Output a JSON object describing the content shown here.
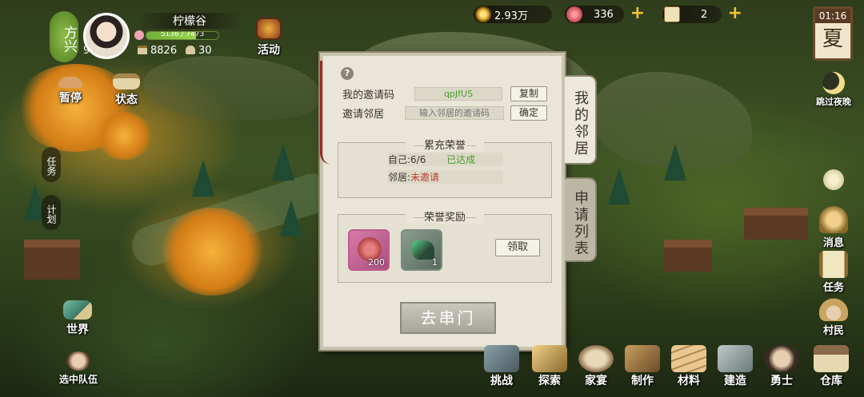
{
  "top_bar": {
    "coins": {
      "icon": "coin-icon",
      "value": "2.93万"
    },
    "gems": {
      "icon": "gem-icon",
      "value": "336"
    },
    "tickets": {
      "icon": "ticket-icon",
      "value": "2"
    },
    "clock": {
      "time": "01:16",
      "season": "夏"
    }
  },
  "player": {
    "village_badge": "方兴",
    "name": "柠檬谷",
    "level": "9",
    "hp_text": "5136 / 7473",
    "hp_ratio": 0.69,
    "prosperity": "8826",
    "population": "30"
  },
  "left_buttons": {
    "activity": "活动",
    "pause": "暂停",
    "status": "状态",
    "task": "任务",
    "plan": "计划",
    "world": "世界",
    "select_team": "选中队伍"
  },
  "panel": {
    "help_symbol": "?",
    "my_code_label": "我的邀请码",
    "my_code_value": "qpJfUS",
    "copy_button": "复制",
    "invite_label": "邀请邻居",
    "invite_placeholder": "输入邻居的邀请码",
    "confirm_button": "确定",
    "honor_title": "累充荣誉",
    "self_label": "自己:6/6",
    "self_status": "已达成",
    "neighbor_label": "邻居:",
    "neighbor_status": "未邀请",
    "reward_title": "荣誉奖励",
    "rewards": [
      {
        "icon": "medal-icon",
        "count": "200"
      },
      {
        "icon": "jade-stone-icon",
        "count": "1"
      }
    ],
    "claim_button": "领取",
    "go_button": "去串门"
  },
  "side_tabs": {
    "my_neighbors": "我的邻居",
    "apply_list": "申请列表"
  },
  "right_buttons": {
    "skip_night": "跳过夜晚",
    "messages": "消息",
    "tasks": "任务",
    "villagers": "村民"
  },
  "dock": [
    {
      "label": "挑战",
      "icon": "challenge-icon"
    },
    {
      "label": "探索",
      "icon": "explore-icon"
    },
    {
      "label": "家宴",
      "icon": "feast-icon"
    },
    {
      "label": "制作",
      "icon": "craft-icon"
    },
    {
      "label": "材料",
      "icon": "materials-icon"
    },
    {
      "label": "建造",
      "icon": "build-icon"
    },
    {
      "label": "勇士",
      "icon": "warrior-icon"
    },
    {
      "label": "仓库",
      "icon": "warehouse-icon"
    }
  ],
  "colors": {
    "accent_gold": "#f2c23a",
    "achieved_green": "#4a9a2a",
    "uninvited_red": "#c0392b",
    "panel_bg": "#e9e6d9"
  }
}
